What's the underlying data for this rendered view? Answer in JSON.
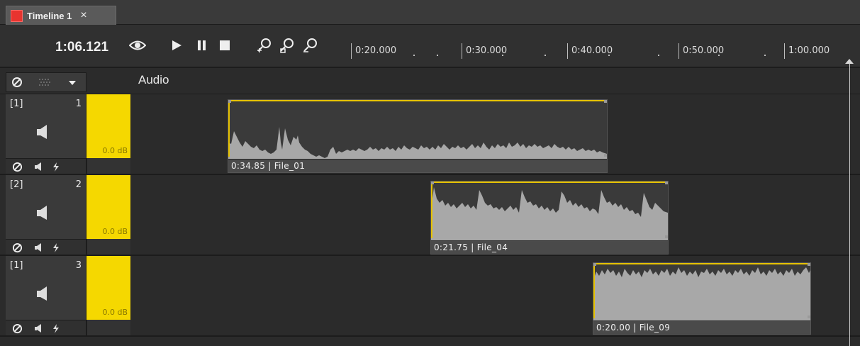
{
  "tab": {
    "label": "Timeline 1",
    "close": "×",
    "color": "#e8342f"
  },
  "toolbar": {
    "time": "1:06.121",
    "buttons": [
      "eye-icon",
      "play-icon",
      "pause-icon",
      "stop-icon",
      "zoom-in-icon",
      "zoom-fit-icon",
      "zoom-out-icon"
    ]
  },
  "ruler": {
    "labels": [
      "0:20.000",
      "0:30.000",
      "0:40.000",
      "0:50.000",
      "1:00.000"
    ]
  },
  "header": {
    "title": "Audio"
  },
  "tracks": [
    {
      "index": "[1]",
      "number": "1",
      "volume": "0.0 dB",
      "clip": {
        "label": "0:34.85 | File_01"
      }
    },
    {
      "index": "[2]",
      "number": "2",
      "volume": "0.0 dB",
      "clip": {
        "label": "0:21.75 | File_04"
      }
    },
    {
      "index": "[1]",
      "number": "3",
      "volume": "0.0 dB",
      "clip": {
        "label": "0:20.00 | File_09"
      }
    }
  ],
  "colors": {
    "accent": "#f5d800",
    "envelope": "#e6c200",
    "background": "#2b2b2b"
  }
}
